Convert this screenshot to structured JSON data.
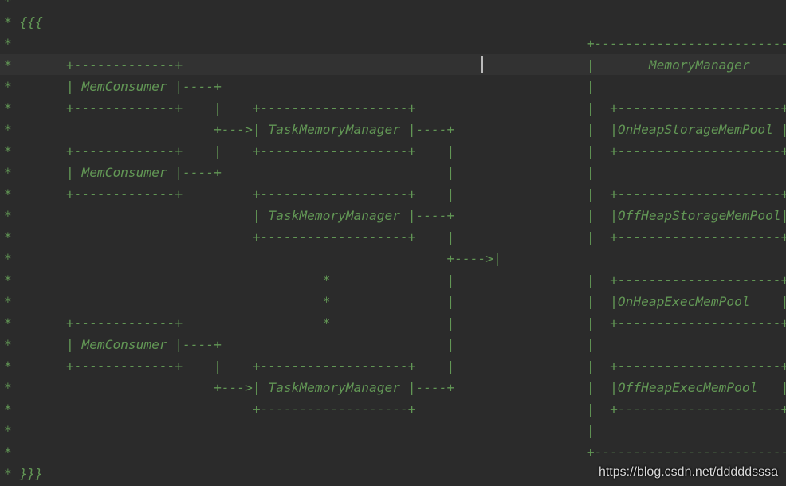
{
  "editor": {
    "lines": [
      "*",
      "* {{{",
      "*                                                                          +---------------------------+",
      "*       +-------------+                                                    |       MemoryManager       |",
      "*       | MemConsumer |----+                                               |                           |",
      "*       +-------------+    |    +-------------------+                      |  +---------------------+  |",
      "*                          +--->| TaskMemoryManager |----+                 |  |OnHeapStorageMemPool |  |",
      "*       +-------------+    |    +-------------------+    |                 |  +---------------------+  |",
      "*       | MemConsumer |----+                             |                 |                           |",
      "*       +-------------+         +-------------------+    |                 |  +---------------------+  |",
      "*                               | TaskMemoryManager |----+                 |  |OffHeapStorageMemPool|  |",
      "*                               +-------------------+    |                 |  +---------------------+  |",
      "*                                                        +---->|                                        |",
      "*                                        *               |                 |  +---------------------+  |",
      "*                                        *               |                 |  |OnHeapExecMemPool    |  |",
      "*       +-------------+                  *               |                 |  +---------------------+  |",
      "*       | MemConsumer |----+                             |                 |                           |",
      "*       +-------------+    |    +-------------------+    |                 |  +---------------------+  |",
      "*                          +--->| TaskMemoryManager |----+                 |  |OffHeapExecMemPool   |  |",
      "*                               +-------------------+                      |  +---------------------+  |",
      "*                                                                          |                           |",
      "*                                                                          +---------------------------+",
      "* }}}"
    ]
  },
  "watermark": {
    "text": "https://blog.csdn.net/dddddsssa"
  }
}
